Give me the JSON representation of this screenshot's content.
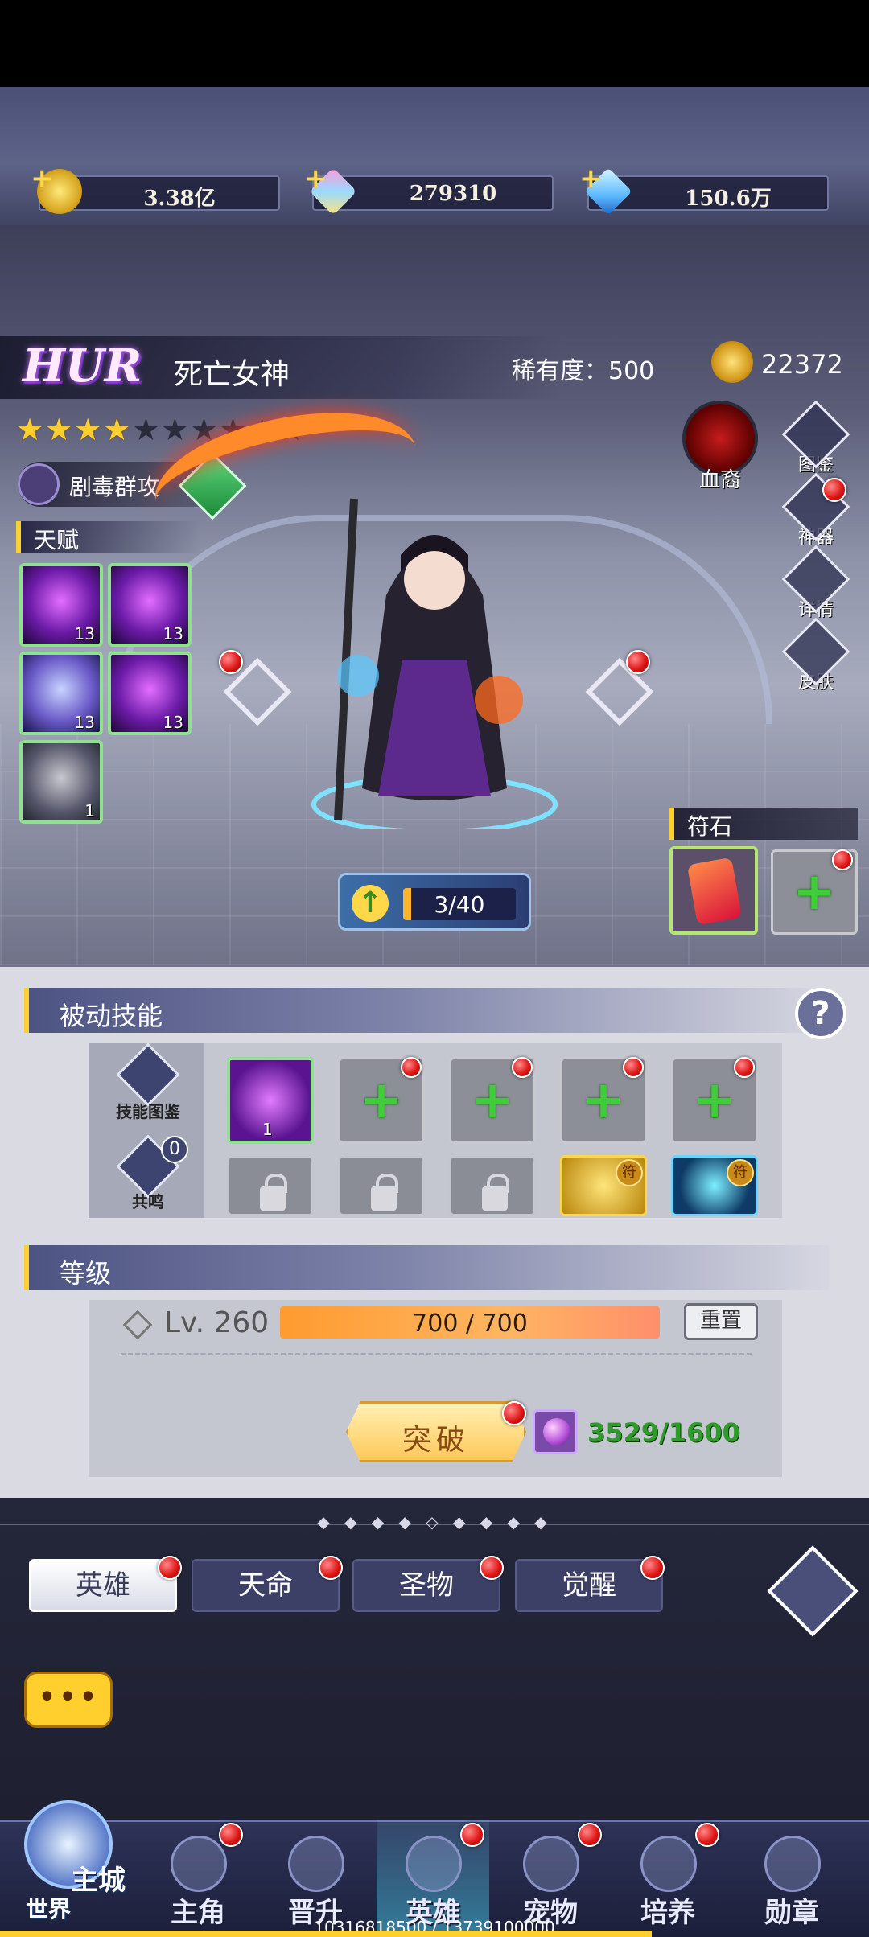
{
  "currency": [
    {
      "icon": "gold-coin-icon",
      "value": "3.38亿"
    },
    {
      "icon": "rainbow-crystal-icon",
      "value": "279310"
    },
    {
      "icon": "blue-diamond-icon",
      "value": "150.6万"
    }
  ],
  "hero": {
    "rarity_tier": "HUR",
    "name": "死亡女神",
    "rarity_label": "稀有度：500",
    "power": "22372",
    "stars_total": 10,
    "stars_lit": 4,
    "skill_tag": "剧毒群攻",
    "talent_title": "天赋",
    "talents": [
      {
        "level": "13"
      },
      {
        "level": "13"
      },
      {
        "level": "13"
      },
      {
        "level": "13"
      },
      {
        "level": "1"
      }
    ],
    "advance_progress": "3/40",
    "pet_label": "血裔",
    "rune_title": "符石"
  },
  "side_buttons": [
    {
      "label": "图鉴",
      "icon": "codex-icon"
    },
    {
      "label": "神器",
      "icon": "artifact-icon"
    },
    {
      "label": "详情",
      "icon": "magnifier-icon"
    },
    {
      "label": "皮肤",
      "icon": "skin-icon"
    }
  ],
  "passive": {
    "title": "被动技能",
    "help": "?",
    "codex_label": "技能图鉴",
    "resonance_label": "共鸣",
    "resonance_count": "0",
    "equipped_level": "1",
    "seal_glyph": "符"
  },
  "level": {
    "title": "等级",
    "lv": "Lv. 260",
    "exp": "700 / 700",
    "exp_fraction": 1.0,
    "reset_label": "重置",
    "break_label": "突破",
    "orb_count": "3529/1600"
  },
  "tabs": [
    {
      "label": "英雄",
      "active": true
    },
    {
      "label": "天命",
      "active": false
    },
    {
      "label": "圣物",
      "active": false
    },
    {
      "label": "觉醒",
      "active": false
    }
  ],
  "chat_label": "•••",
  "nav": {
    "home_top": "主城",
    "home_bottom": "世界",
    "items": [
      {
        "label": "主角",
        "active": false
      },
      {
        "label": "晋升",
        "active": false
      },
      {
        "label": "英雄",
        "active": true
      },
      {
        "label": "宠物",
        "active": false
      },
      {
        "label": "培养",
        "active": false
      },
      {
        "label": "勋章",
        "active": false
      }
    ],
    "exp_footer": "10316818500 / 13739100000"
  },
  "colors": {
    "gold": "#ffcf2e",
    "accent_green": "#3fce3a",
    "panel": "#d9dae2",
    "nav": "#2e3358"
  }
}
